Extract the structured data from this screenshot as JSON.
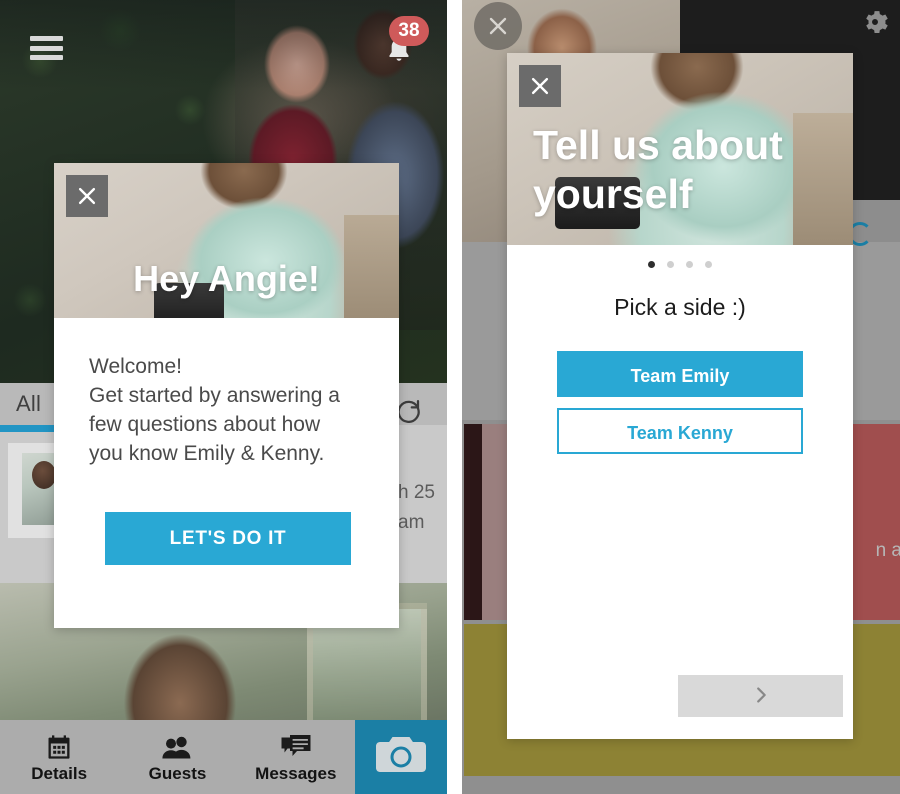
{
  "left_screen": {
    "header": {
      "menu_icon": "hamburger-menu-icon",
      "bell_icon": "bell-icon",
      "notification_count": "38"
    },
    "tabs": {
      "active_label": "All"
    },
    "feed": {
      "refresh_icon": "refresh-icon",
      "meta_line_1": "h 25",
      "meta_line_2": "am"
    },
    "modal": {
      "close_icon": "close-x-icon",
      "hero_title": "Hey Angie!",
      "body_text": "Welcome!\nGet started by answering a\nfew questions about how\nyou know Emily & Kenny.",
      "cta_label": "LET'S DO IT"
    },
    "bottom_nav": {
      "items": [
        {
          "label": "Details",
          "icon": "calendar-icon"
        },
        {
          "label": "Guests",
          "icon": "people-icon"
        },
        {
          "label": "Messages",
          "icon": "chat-bubbles-icon"
        }
      ],
      "camera_icon": "camera-icon"
    }
  },
  "right_screen": {
    "header": {
      "close_icon": "close-x-circle-icon",
      "gear_icon": "gear-icon"
    },
    "background": {
      "text_hint": "n a"
    },
    "modal": {
      "close_icon": "close-x-icon",
      "hero_title": "Tell us about yourself",
      "dots": {
        "total": 4,
        "active_index": 0
      },
      "question": "Pick a side :)",
      "choices": [
        {
          "label": "Team Emily",
          "style": "filled"
        },
        {
          "label": "Team Kenny",
          "style": "outline"
        }
      ],
      "next_icon": "chevron-right-icon"
    }
  },
  "colors": {
    "accent_teal": "#29a8d4",
    "camera_teal": "#1b7fa5",
    "badge_red": "#cf5a5a",
    "next_grey": "#d9d9d9"
  }
}
